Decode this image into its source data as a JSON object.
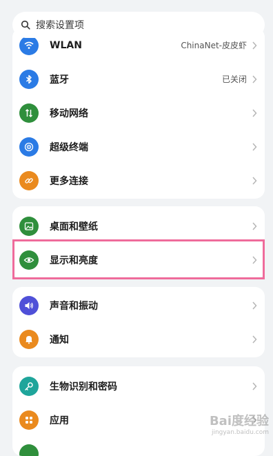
{
  "search": {
    "placeholder": "搜索设置项"
  },
  "groups": [
    {
      "items": [
        {
          "label": "WLAN",
          "value": "ChinaNet-皮皮虾",
          "icon": "wifi-icon",
          "color": "#2b7be5"
        },
        {
          "label": "蓝牙",
          "value": "已关闭",
          "icon": "bluetooth-icon",
          "color": "#2b7be5"
        },
        {
          "label": "移动网络",
          "value": "",
          "icon": "mobile-network-icon",
          "color": "#2f8f3c"
        },
        {
          "label": "超级终端",
          "value": "",
          "icon": "super-device-icon",
          "color": "#2b7be5"
        },
        {
          "label": "更多连接",
          "value": "",
          "icon": "link-icon",
          "color": "#ea8a1e"
        }
      ]
    },
    {
      "items": [
        {
          "label": "桌面和壁纸",
          "value": "",
          "icon": "wallpaper-icon",
          "color": "#2f8f3c"
        },
        {
          "label": "显示和亮度",
          "value": "",
          "icon": "eye-icon",
          "color": "#2f8f3c"
        }
      ]
    },
    {
      "items": [
        {
          "label": "声音和振动",
          "value": "",
          "icon": "volume-icon",
          "color": "#4f50d8"
        },
        {
          "label": "通知",
          "value": "",
          "icon": "bell-icon",
          "color": "#ea8a1e"
        }
      ]
    },
    {
      "items": [
        {
          "label": "生物识别和密码",
          "value": "",
          "icon": "key-icon",
          "color": "#1fa59b"
        },
        {
          "label": "应用",
          "value": "",
          "icon": "apps-icon",
          "color": "#ea8a1e"
        }
      ]
    }
  ],
  "watermark": {
    "logo": "Bai度经验",
    "sub": "jingyan.baidu.com"
  }
}
